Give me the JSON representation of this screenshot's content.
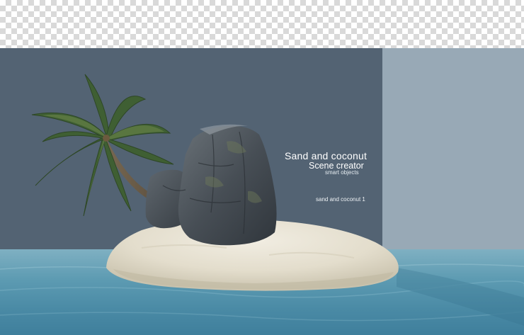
{
  "overlay": {
    "title": "Sand and coconut",
    "subtitle": "Scene creator",
    "tagline": "smart objects",
    "layer_label": "sand and coconut 1"
  },
  "colors": {
    "dark_backdrop": "#536373",
    "light_backdrop": "#98a9b6",
    "water": "#5d9bb2",
    "sand": "#e7e2d3",
    "rock": "#4a5158",
    "palm_leaf": "#3f5f33"
  },
  "scene_objects": [
    "palm-tree",
    "rock-formation",
    "sand-island",
    "sea-water",
    "transparency-checkerboard"
  ]
}
